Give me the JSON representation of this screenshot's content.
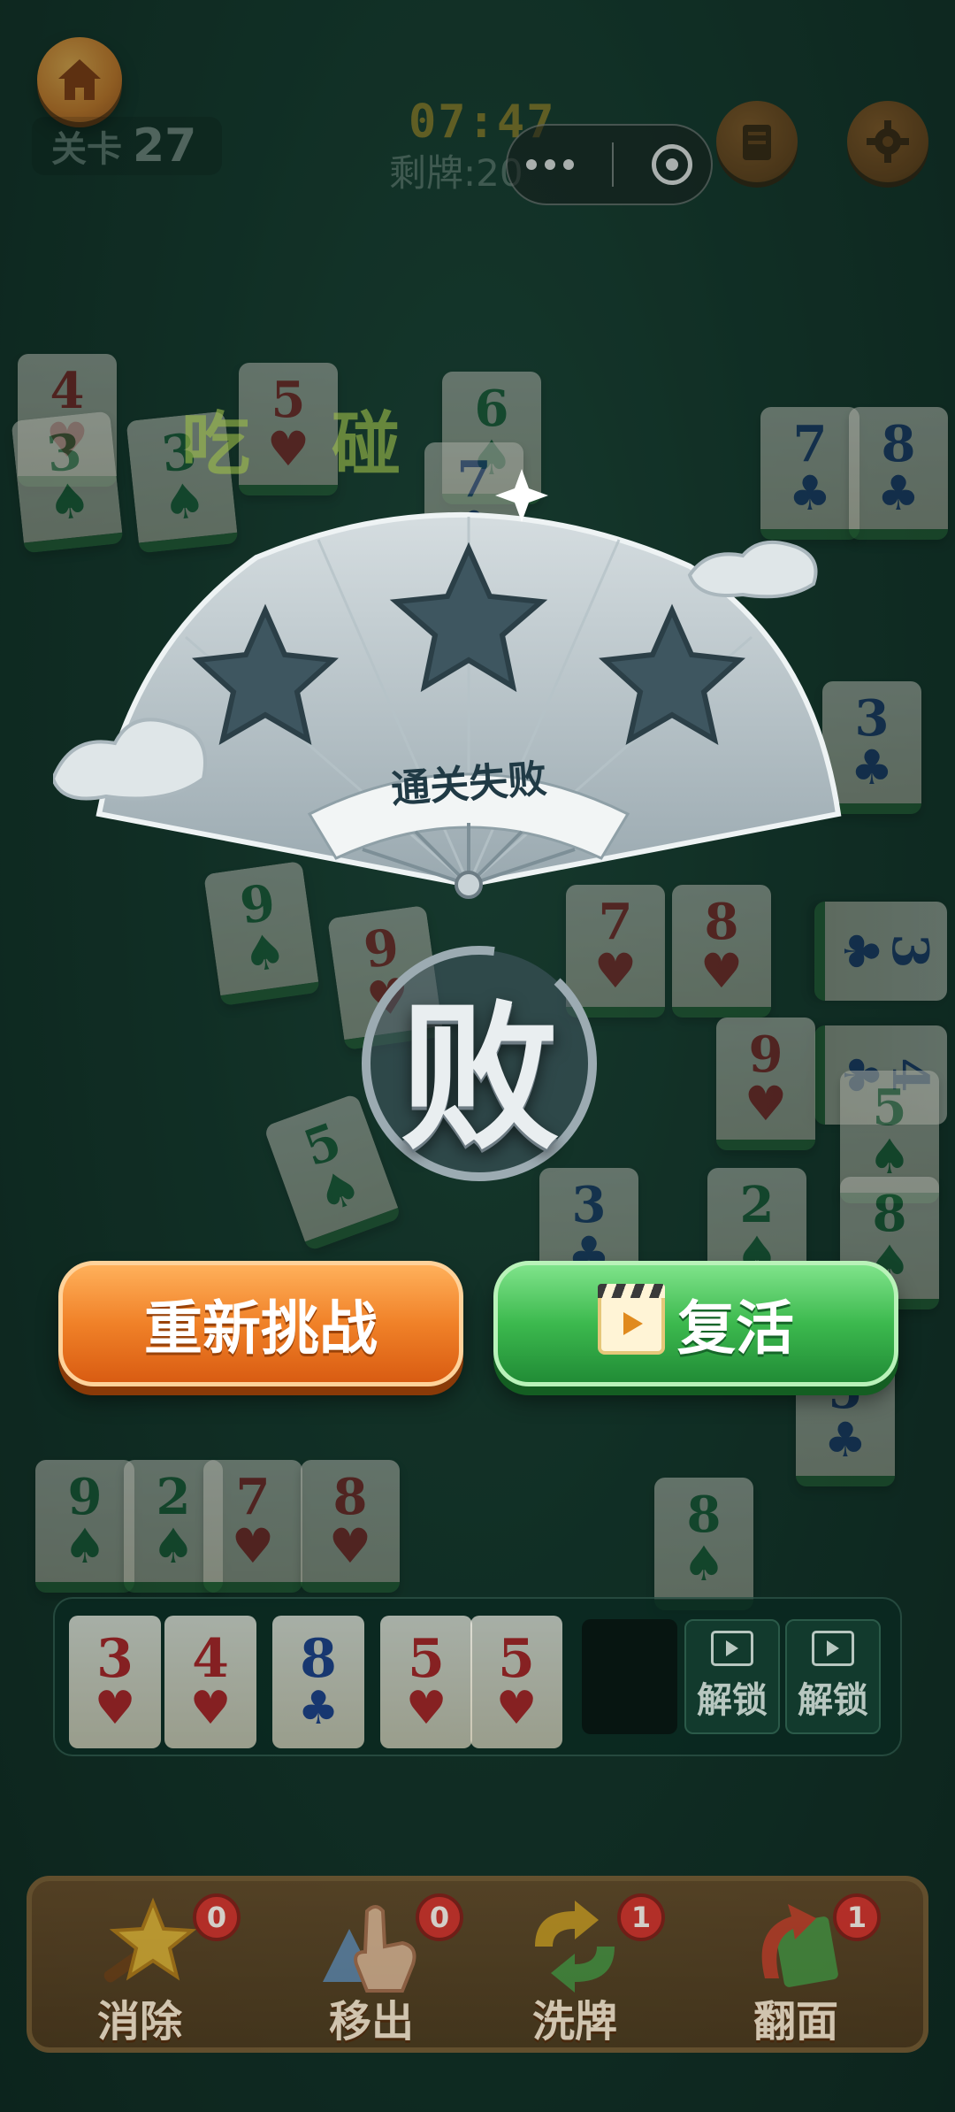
{
  "hud": {
    "level_label": "关卡",
    "level_number": "27",
    "timer": "07:47",
    "remaining": "剩牌:20"
  },
  "icons": {
    "home": "home-icon",
    "more": "more-dots-icon",
    "close": "close-target-icon",
    "rules": "book-icon",
    "settings": "gear-icon"
  },
  "result": {
    "banner_text": "通关失败",
    "stars_earned": 0,
    "stars_total": 3,
    "badge_glyph": "败",
    "pair_hint_1": "吃",
    "pair_hint_2": "碰"
  },
  "buttons": {
    "retry_label": "重新挑战",
    "revive_label": "复活"
  },
  "board_tiles": [
    {
      "rank": "4",
      "suit": "♥",
      "color": "red"
    },
    {
      "rank": "3",
      "suit": "♠",
      "color": "green"
    },
    {
      "rank": "3",
      "suit": "♠",
      "color": "green"
    },
    {
      "rank": "5",
      "suit": "♥",
      "color": "red"
    },
    {
      "rank": "6",
      "suit": "♠",
      "color": "green"
    },
    {
      "rank": "7",
      "suit": "♣",
      "color": "blue"
    },
    {
      "rank": "8",
      "suit": "♣",
      "color": "blue"
    },
    {
      "rank": "3",
      "suit": "♣",
      "color": "blue"
    },
    {
      "rank": "9",
      "suit": "♠",
      "color": "green"
    },
    {
      "rank": "9",
      "suit": "♥",
      "color": "red"
    },
    {
      "rank": "7",
      "suit": "♥",
      "color": "red"
    },
    {
      "rank": "8",
      "suit": "♥",
      "color": "red"
    },
    {
      "rank": "3",
      "suit": "♣",
      "color": "blue"
    },
    {
      "rank": "4",
      "suit": "♣",
      "color": "blue"
    },
    {
      "rank": "9",
      "suit": "♥",
      "color": "red"
    },
    {
      "rank": "5",
      "suit": "♠",
      "color": "green"
    },
    {
      "rank": "3",
      "suit": "♣",
      "color": "blue"
    },
    {
      "rank": "2",
      "suit": "♠",
      "color": "green"
    },
    {
      "rank": "8",
      "suit": "♠",
      "color": "green"
    },
    {
      "rank": "5",
      "suit": "♠",
      "color": "green"
    },
    {
      "rank": "5",
      "suit": "♣",
      "color": "blue"
    },
    {
      "rank": "9",
      "suit": "♠",
      "color": "green"
    },
    {
      "rank": "2",
      "suit": "♠",
      "color": "green"
    },
    {
      "rank": "7",
      "suit": "♥",
      "color": "red"
    },
    {
      "rank": "8",
      "suit": "♥",
      "color": "red"
    },
    {
      "rank": "8",
      "suit": "♠",
      "color": "green"
    },
    {
      "rank": "7",
      "suit": "♣",
      "color": "blue"
    }
  ],
  "slots": [
    {
      "rank": "3",
      "suit": "♥",
      "color": "red"
    },
    {
      "rank": "4",
      "suit": "♥",
      "color": "red"
    },
    {
      "rank": "8",
      "suit": "♣",
      "color": "blue"
    },
    {
      "rank": "5",
      "suit": "♥",
      "color": "red"
    },
    {
      "rank": "5",
      "suit": "♥",
      "color": "red"
    }
  ],
  "locked_slots": [
    {
      "label": "解锁"
    },
    {
      "label": "解锁"
    }
  ],
  "tools": [
    {
      "label": "消除",
      "count": "0",
      "icon": "magic-wand-star-icon"
    },
    {
      "label": "移出",
      "count": "0",
      "icon": "hand-pointer-icon"
    },
    {
      "label": "洗牌",
      "count": "1",
      "icon": "shuffle-arrows-icon"
    },
    {
      "label": "翻面",
      "count": "1",
      "icon": "flip-arrow-icon"
    }
  ],
  "colors": {
    "felt": "#1a4234",
    "retry_orange": "#f08128",
    "revive_green": "#3cb94e",
    "tile_green_edge": "#2f7a3e"
  }
}
